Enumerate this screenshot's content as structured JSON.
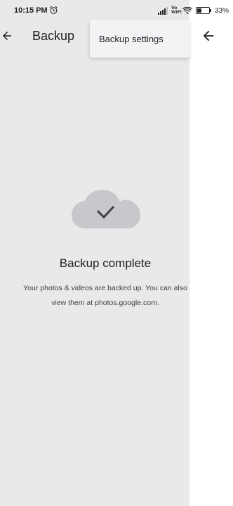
{
  "status_bar": {
    "time": "10:15 PM",
    "volte": "Vo\nWiFi",
    "battery_percent": "33%",
    "battery_level": 0.33
  },
  "app_bar": {
    "title": "Backup",
    "back_icon": "arrow-back-icon"
  },
  "menu": {
    "items": [
      {
        "label": "Backup settings"
      }
    ]
  },
  "content": {
    "icon": "cloud-done-icon",
    "title": "Backup complete",
    "description": "Your photos & videos are backed up. You can also view them at photos.google.com."
  },
  "colors": {
    "dim_background": "#e9e9e9",
    "cloud": "#c8c8cc",
    "menu_background": "#f2f3f5"
  }
}
